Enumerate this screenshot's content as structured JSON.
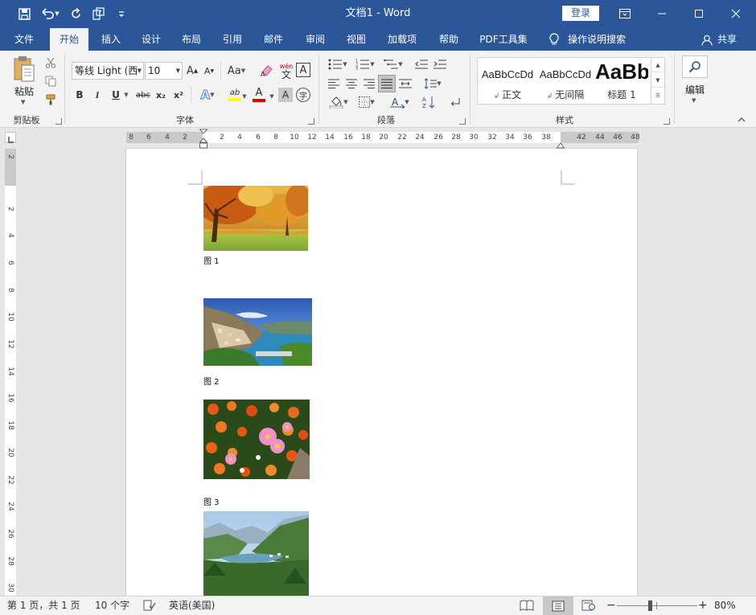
{
  "title_bar": {
    "document_name": "文档1",
    "app_name": "Word",
    "separator": " - ",
    "login_label": "登录",
    "quick_access": [
      "save-icon",
      "undo-icon",
      "undo-dropdown-icon",
      "redo-icon",
      "touch-mode-icon",
      "customize-qat-icon"
    ],
    "window_controls": [
      "ribbon-display-icon",
      "minimize-icon",
      "maximize-icon",
      "close-icon"
    ]
  },
  "tabs": {
    "items": [
      "文件",
      "开始",
      "插入",
      "设计",
      "布局",
      "引用",
      "邮件",
      "审阅",
      "视图",
      "加载项",
      "帮助",
      "PDF工具集"
    ],
    "active": "开始",
    "tell_me": "操作说明搜索",
    "share": "共享"
  },
  "ribbon": {
    "clipboard": {
      "label": "剪贴板",
      "paste": "粘贴"
    },
    "font": {
      "label": "字体",
      "font_name": "等线 Light (西",
      "font_size": "10",
      "phonetic_top": "wén",
      "phonetic_bottom": "文",
      "border_char": "A",
      "enclose_char": "字",
      "change_case": "Aa",
      "bold": "B",
      "italic": "I",
      "underline": "U",
      "strike": "abc",
      "subscript": "x₂",
      "superscript": "x²",
      "grow": "A",
      "shrink": "A",
      "effects": "A",
      "highlight": "ab",
      "font_color": "A",
      "shading": "A"
    },
    "paragraph": {
      "label": "段落"
    },
    "styles": {
      "label": "样式",
      "items": [
        {
          "sample": "AaBbCcDd",
          "name": "正文"
        },
        {
          "sample": "AaBbCcDd",
          "name": "无间隔"
        },
        {
          "sample": "AaBb",
          "name": "标题 1"
        }
      ]
    },
    "editing": {
      "label": "编辑"
    }
  },
  "ruler": {
    "h_left": [
      "8",
      "6",
      "4",
      "2"
    ],
    "h_main": [
      "2",
      "4",
      "6",
      "8",
      "10",
      "12",
      "14",
      "16",
      "18",
      "20",
      "22",
      "24",
      "26",
      "28",
      "30",
      "32",
      "34",
      "36",
      "38"
    ],
    "h_right": [
      "42",
      "44",
      "46",
      "48"
    ],
    "v_top": [
      "2"
    ],
    "v_main": [
      "2",
      "4",
      "6",
      "8",
      "10",
      "12",
      "14",
      "16",
      "18",
      "20",
      "22",
      "24",
      "26",
      "28",
      "30"
    ]
  },
  "document": {
    "captions": [
      "图 1",
      "图 2",
      "图 3"
    ]
  },
  "status_bar": {
    "page": "第 1 页，共 1 页",
    "words": "10 个字",
    "language": "英语(美国)",
    "zoom": "80%",
    "zoom_minus": "−",
    "zoom_plus": "+",
    "zoom_level": 0.5
  },
  "colors": {
    "accent": "#2b579a",
    "ribbon_bg": "#f3f3f3",
    "canvas_bg": "#e6e6e6"
  }
}
